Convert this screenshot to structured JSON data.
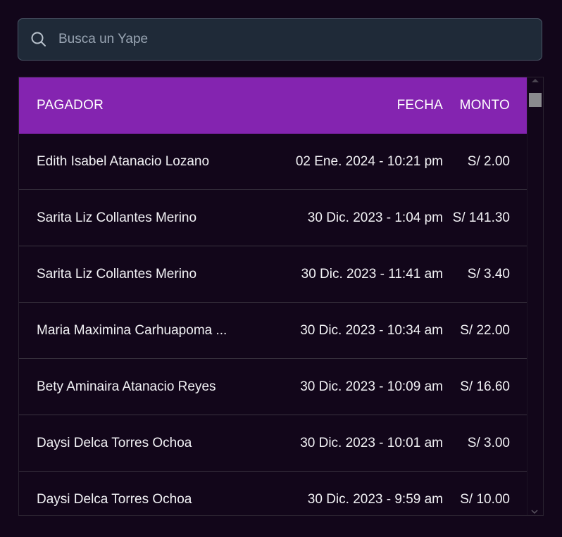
{
  "search": {
    "placeholder": "Busca un Yape",
    "value": ""
  },
  "table": {
    "headers": {
      "payer": "PAGADOR",
      "date": "FECHA",
      "amount": "MONTO"
    },
    "rows": [
      {
        "payer": "Edith Isabel Atanacio Lozano",
        "date": "02 Ene. 2024 - 10:21 pm",
        "amount": "S/ 2.00"
      },
      {
        "payer": "Sarita Liz Collantes Merino",
        "date": "30 Dic. 2023 - 1:04 pm",
        "amount": "S/ 141.30"
      },
      {
        "payer": "Sarita Liz Collantes Merino",
        "date": "30 Dic. 2023 - 11:41 am",
        "amount": "S/ 3.40"
      },
      {
        "payer": "Maria Maximina Carhuapoma ...",
        "date": "30 Dic. 2023 - 10:34 am",
        "amount": "S/ 22.00"
      },
      {
        "payer": "Bety Aminaira Atanacio Reyes",
        "date": "30 Dic. 2023 - 10:09 am",
        "amount": "S/ 16.60"
      },
      {
        "payer": "Daysi Delca Torres Ochoa",
        "date": "30 Dic. 2023 - 10:01 am",
        "amount": "S/ 3.00"
      },
      {
        "payer": "Daysi Delca Torres Ochoa",
        "date": "30 Dic. 2023 - 9:59 am",
        "amount": "S/ 10.00"
      }
    ]
  },
  "colors": {
    "background": "#12061a",
    "header_accent": "#8424b0",
    "search_background": "#1f2a38"
  },
  "icons": {
    "search": "search-icon",
    "scroll_down": "chevron-down-icon"
  }
}
